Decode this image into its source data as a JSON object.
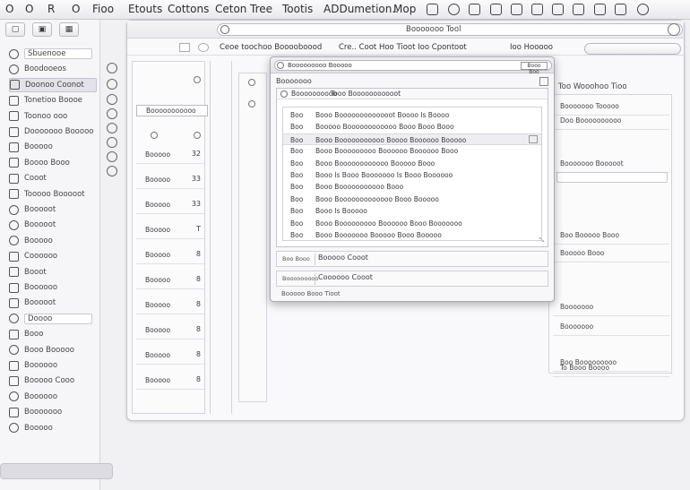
{
  "menubar": {
    "items": [
      "O",
      "O",
      "R",
      "O",
      "Fioo",
      "Etouts",
      "Cottons",
      "Ceton",
      "Tree",
      "Tootis",
      "ADDumetion..",
      "Mop"
    ],
    "icons": [
      "pen-icon",
      "disc-icon",
      "chart-icon",
      "grid-icon",
      "grid-icon",
      "camera-icon",
      "pen-icon",
      "tag-icon",
      "bolt-icon",
      "tag-icon",
      "circle-icon"
    ]
  },
  "sidebar": {
    "top_buttons": [
      "▢",
      "▣",
      "▦"
    ],
    "items": [
      {
        "label": "Sbuenooe",
        "kind": "field-round"
      },
      {
        "label": "Boodooeos",
        "kind": "round"
      },
      {
        "label": "Doonoo Coonot",
        "kind": "selected"
      },
      {
        "label": "Tonetioo Boooe",
        "kind": "square"
      },
      {
        "label": "Toonoo ooo",
        "kind": "square"
      },
      {
        "label": "Dooooooo Booooo",
        "kind": "square"
      },
      {
        "label": "Booooo",
        "kind": "square"
      },
      {
        "label": "Boooo Booo",
        "kind": "square"
      },
      {
        "label": "Cooot",
        "kind": "square"
      },
      {
        "label": "Tooooo Booooot",
        "kind": "square"
      },
      {
        "label": "Booooot",
        "kind": "round"
      },
      {
        "label": "Booooot",
        "kind": "round"
      },
      {
        "label": "Booooo",
        "kind": "round"
      },
      {
        "label": "Coooooo",
        "kind": "square"
      },
      {
        "label": "Booot",
        "kind": "square"
      },
      {
        "label": "Boooooo",
        "kind": "square"
      },
      {
        "label": "Booooot",
        "kind": "square"
      },
      {
        "label": "Doooo",
        "kind": "field-round"
      },
      {
        "label": "Booo",
        "kind": "square"
      },
      {
        "label": "Booo Booooo",
        "kind": "round"
      },
      {
        "label": "Boooooo",
        "kind": "square"
      },
      {
        "label": "Booooo Cooo",
        "kind": "square"
      },
      {
        "label": "Boooooo",
        "kind": "round"
      },
      {
        "label": "Booooooo",
        "kind": "square"
      },
      {
        "label": "Booooo",
        "kind": "round"
      }
    ]
  },
  "window": {
    "search_text": "Booooooo Tool",
    "tabbar": {
      "left_text": "Ceoe toochoo Booooboood",
      "mid_text": "Cre.. Coot Hoo Tioot Ioo Cpontoot",
      "right_text": "Ioo Hooooo"
    },
    "left_panel": {
      "field": "Booooooooooo",
      "rows": [
        {
          "label": "Booooo",
          "value": "32"
        },
        {
          "label": "Booooo",
          "value": "33"
        },
        {
          "label": "Booooo",
          "value": "33"
        },
        {
          "label": "Booooo",
          "value": "T"
        },
        {
          "label": "Booooo",
          "value": "8"
        },
        {
          "label": "Booooo",
          "value": "8"
        },
        {
          "label": "Booooo",
          "value": "8"
        },
        {
          "label": "Booooo",
          "value": "8"
        },
        {
          "label": "Booooo",
          "value": "8"
        },
        {
          "label": "Booooo",
          "value": "8"
        }
      ]
    },
    "right_panel": {
      "header": "Too  Wooohoo Tioo",
      "items": [
        "Booooooo Tooooo",
        "Doo Boooooooooo",
        "Booooooo Booooot",
        "Boo Booooo Booo",
        "Booooo Booo",
        "Booooooo",
        "Booooooo",
        "Boo Booooooooo",
        "To Booo Boooo"
      ]
    }
  },
  "dialog": {
    "title": "Booooooooo Booooo",
    "title_btn": "Booo Boo",
    "row2_label": "Booooooo",
    "list_header_a": "Boooooooooo",
    "list_header_b": "Tooo  Booooooooooot",
    "items": [
      {
        "c1": "Boo",
        "c2": "Booo  Booooooooooooot  Boooo  Is  Boooo",
        "sel": false
      },
      {
        "c1": "Boo",
        "c2": "Booooo  Boooooooooooo  Booo  Booo  Booo",
        "sel": false
      },
      {
        "c1": "Boo",
        "c2": "Booo  Booooooooooo  Boooo  Boooooo  Booooo",
        "sel": true
      },
      {
        "c1": "Boo",
        "c2": "Booo  Booooooooo  Boooooo  Boooooo  Booo",
        "sel": false
      },
      {
        "c1": "Boo",
        "c2": "Booo  Boooooooooooo  Booooo  Booo",
        "sel": false
      },
      {
        "c1": "Boo",
        "c2": "Booo  Is  Booo  Booooooo  Is  Booo  Boooooo",
        "sel": false
      },
      {
        "c1": "Boo",
        "c2": "Booo  Booooooooooo  Booo",
        "sel": false
      },
      {
        "c1": "Boo",
        "c2": "Booo  Booooooooooooo  Booo  Booooo",
        "sel": false
      },
      {
        "c1": "Boo",
        "c2": "Booo  Is  Booooo",
        "sel": false
      },
      {
        "c1": "Boo",
        "c2": "Booo  Booooooooo  Boooooo  Booo  Booooooo",
        "sel": false
      },
      {
        "c1": "Boo",
        "c2": "Booo  Booooooo  Booooo  Booo  Booooo",
        "sel": false
      }
    ],
    "field1_label": "Boo Booo",
    "field1_value": "Booooo Cooot",
    "field2_label": "Booooooooo",
    "field2_value": "Coooooo Cooot",
    "status": "Booooo Booo  Tioot"
  }
}
